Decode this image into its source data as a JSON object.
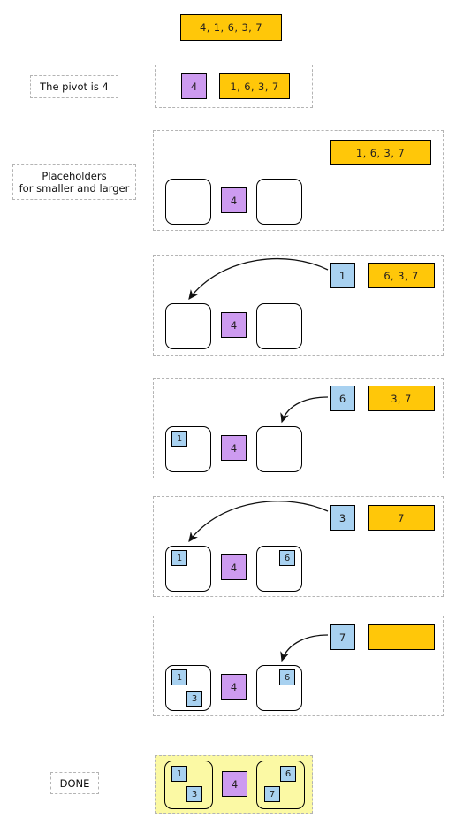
{
  "title": "Quicksort partition walkthrough",
  "palette": {
    "orange": "#ffc709",
    "purple": "#cd9bf0",
    "blue": "#a8d1f0",
    "yellow_done": "#fbf9a4",
    "dash_border": "#b4b4b4",
    "solid_border": "#000000"
  },
  "steps": [
    {
      "id": "initial",
      "caption": "",
      "input_list": "4, 1, 6, 3, 7"
    },
    {
      "id": "pivot",
      "caption": "The pivot is 4",
      "pivot": "4",
      "remaining_list": "1, 6, 3, 7"
    },
    {
      "id": "placeholders",
      "caption": "Placeholders\nfor smaller and larger",
      "pivot": "4",
      "remaining_list": "1, 6, 3, 7",
      "smaller_bucket": [],
      "larger_bucket": []
    },
    {
      "id": "move-1",
      "caption": "",
      "moving_value": "1",
      "pivot": "4",
      "remaining_list": "6, 3, 7",
      "smaller_bucket": [],
      "larger_bucket": [],
      "arrow_target": "smaller"
    },
    {
      "id": "move-6",
      "caption": "",
      "moving_value": "6",
      "pivot": "4",
      "remaining_list": "3, 7",
      "smaller_bucket": [
        "1"
      ],
      "larger_bucket": [],
      "arrow_target": "larger"
    },
    {
      "id": "move-3",
      "caption": "",
      "moving_value": "3",
      "pivot": "4",
      "remaining_list": "7",
      "smaller_bucket": [
        "1"
      ],
      "larger_bucket": [
        "6"
      ],
      "arrow_target": "smaller"
    },
    {
      "id": "move-7",
      "caption": "",
      "moving_value": "7",
      "pivot": "4",
      "remaining_list": "",
      "smaller_bucket": [
        "1",
        "3"
      ],
      "larger_bucket": [
        "6"
      ],
      "arrow_target": "larger"
    },
    {
      "id": "done",
      "caption": "DONE",
      "pivot": "4",
      "smaller_bucket": [
        "1",
        "3"
      ],
      "larger_bucket": [
        "6",
        "7"
      ]
    }
  ],
  "labels": {
    "step0_list": "4, 1, 6, 3, 7",
    "step1_caption": "The pivot is 4",
    "step1_pivot": "4",
    "step1_list": "1, 6, 3, 7",
    "step2_caption": "Placeholders\nfor smaller and larger",
    "step2_pivot": "4",
    "step2_list": "1, 6, 3, 7",
    "step3_moving": "1",
    "step3_pivot": "4",
    "step3_list": "6, 3, 7",
    "step4_moving": "6",
    "step4_pivot": "4",
    "step4_list": "3, 7",
    "step4_small_1": "1",
    "step5_moving": "3",
    "step5_pivot": "4",
    "step5_list": "7",
    "step5_small_1": "1",
    "step5_large_6": "6",
    "step6_moving": "7",
    "step6_pivot": "4",
    "step6_list": "",
    "step6_small_1": "1",
    "step6_small_3": "3",
    "step6_large_6": "6",
    "step7_caption": "DONE",
    "step7_pivot": "4",
    "step7_small_1": "1",
    "step7_small_3": "3",
    "step7_large_6": "6",
    "step7_large_7": "7"
  }
}
